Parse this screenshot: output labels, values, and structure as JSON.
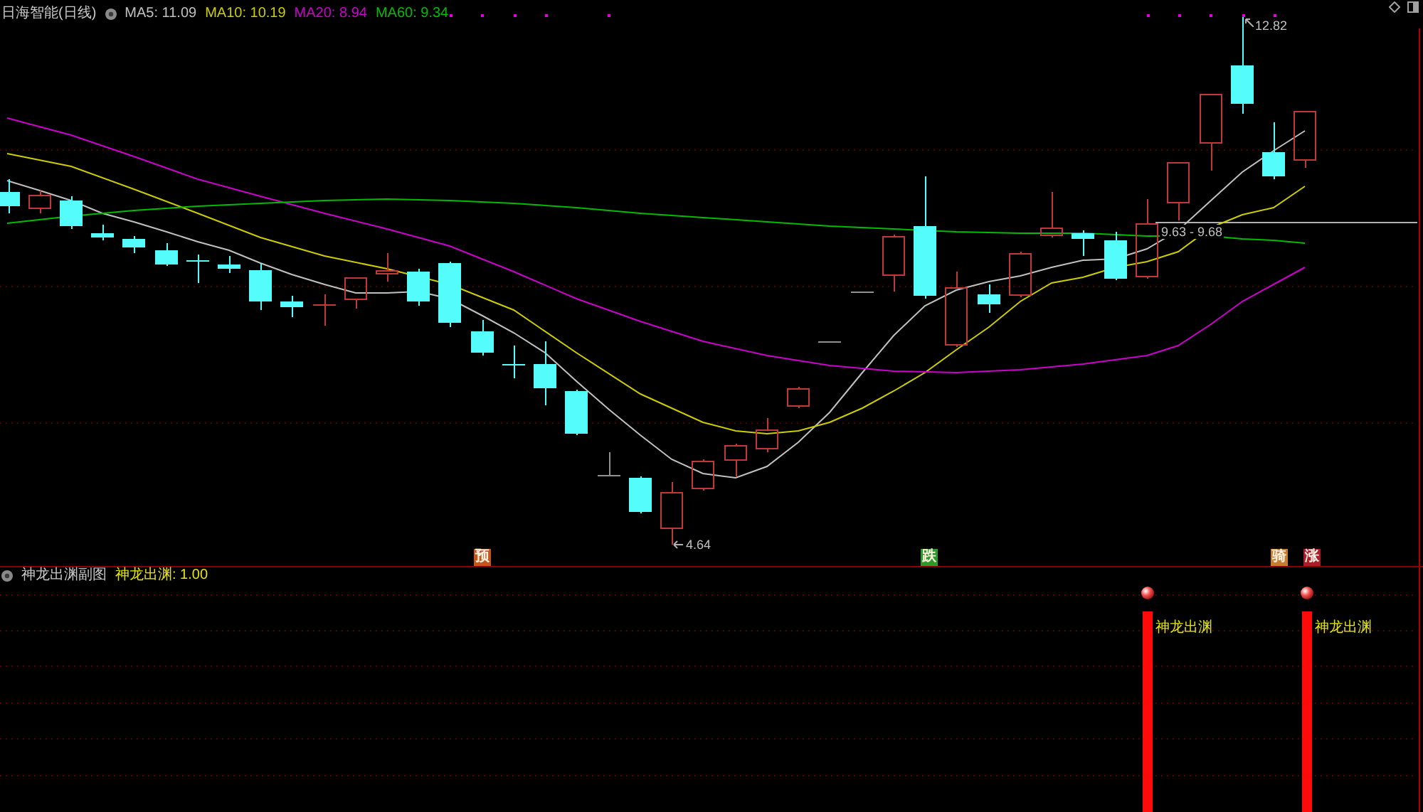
{
  "header": {
    "title": "日海智能(日线)",
    "indicators": [
      {
        "label": "MA5: 11.09",
        "color": "#c0c0c0"
      },
      {
        "label": "MA10: 10.19",
        "color": "#cccc00"
      },
      {
        "label": "MA20: 8.94",
        "color": "#cc00cc"
      },
      {
        "label": "MA60: 9.34",
        "color": "#00bb00"
      }
    ]
  },
  "price_chart": {
    "high_label": "12.82",
    "low_label": "4.64",
    "range_label": "9.63 - 9.68",
    "signals": [
      {
        "text": "预",
        "color": "#c4561c"
      },
      {
        "text": "跌",
        "color": "#2a9a2a"
      },
      {
        "text": "骑",
        "color": "#c87d2e"
      },
      {
        "text": "涨",
        "color": "#a81c2c"
      }
    ]
  },
  "indicator_panel": {
    "title": "神龙出渊副图",
    "reading": "神龙出渊: 1.00",
    "signals": [
      {
        "label": "神龙出渊"
      },
      {
        "label": "神龙出渊"
      }
    ]
  }
}
